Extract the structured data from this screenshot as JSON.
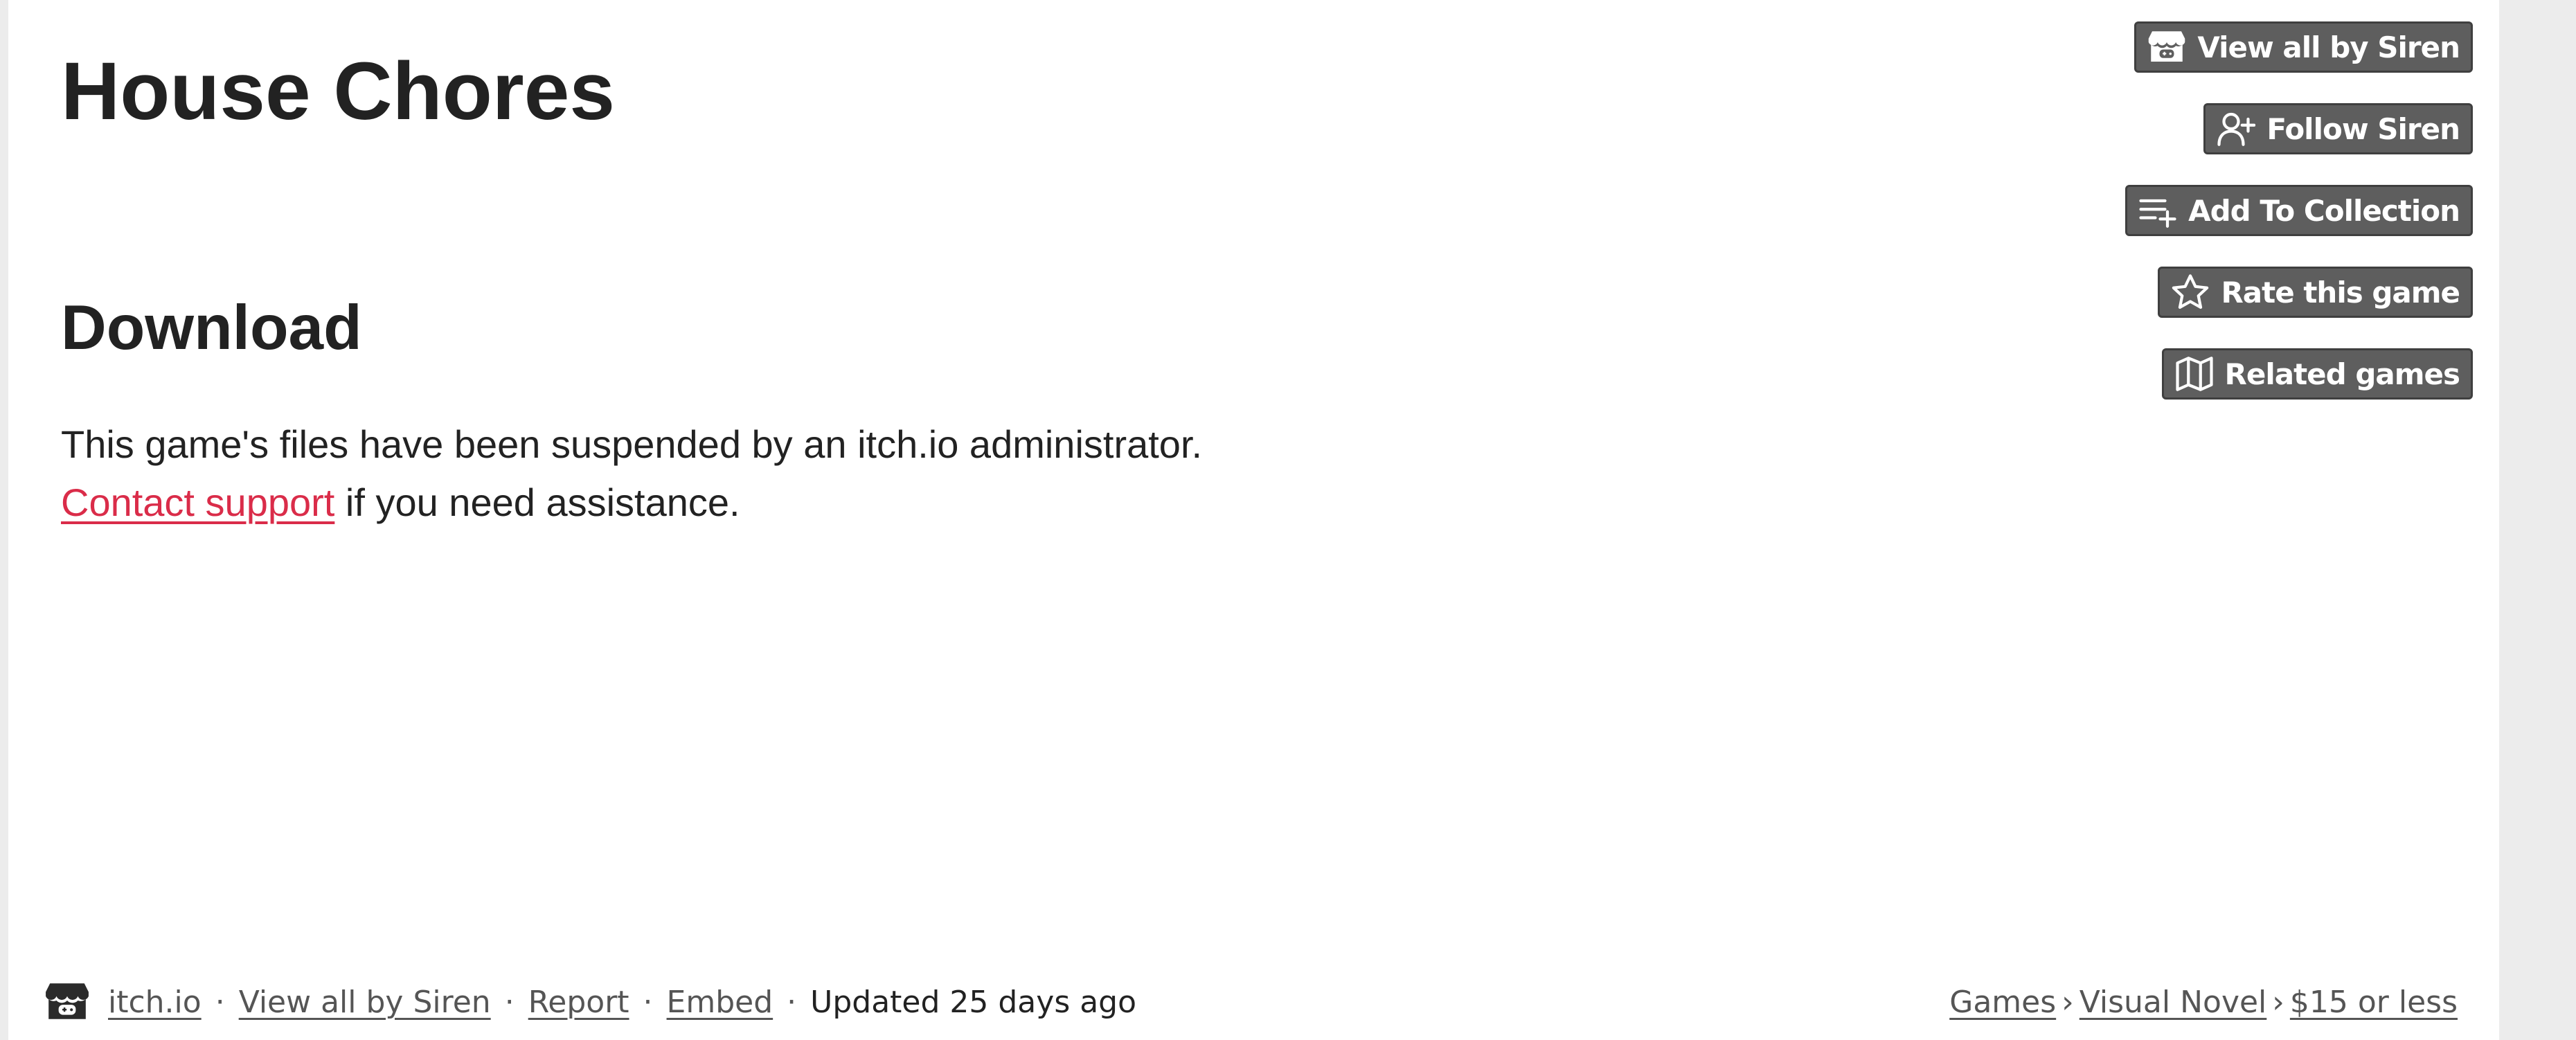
{
  "game": {
    "title": "House Chores"
  },
  "download": {
    "heading": "Download",
    "suspended_message": "This game's files have been suspended by an itch.io administrator.",
    "support_link": "Contact support",
    "support_suffix": " if you need assistance."
  },
  "actions": [
    {
      "label": "View all by Siren",
      "icon": "itchio-logo-icon"
    },
    {
      "label": "Follow Siren",
      "icon": "user-plus-icon"
    },
    {
      "label": "Add To Collection",
      "icon": "playlist-add-icon"
    },
    {
      "label": "Rate this game",
      "icon": "star-icon"
    },
    {
      "label": "Related games",
      "icon": "map-icon"
    }
  ],
  "footer": {
    "site": "itch.io",
    "view_all": "View all by Siren",
    "report": "Report",
    "embed": "Embed",
    "updated": "Updated 25 days ago",
    "breadcrumbs": [
      "Games",
      "Visual Novel",
      "$15 or less"
    ],
    "separator": "·",
    "crumb_separator": "›"
  },
  "colors": {
    "link_red": "#da2c49",
    "button_bg": "#5e5e5e",
    "text": "#222222"
  }
}
